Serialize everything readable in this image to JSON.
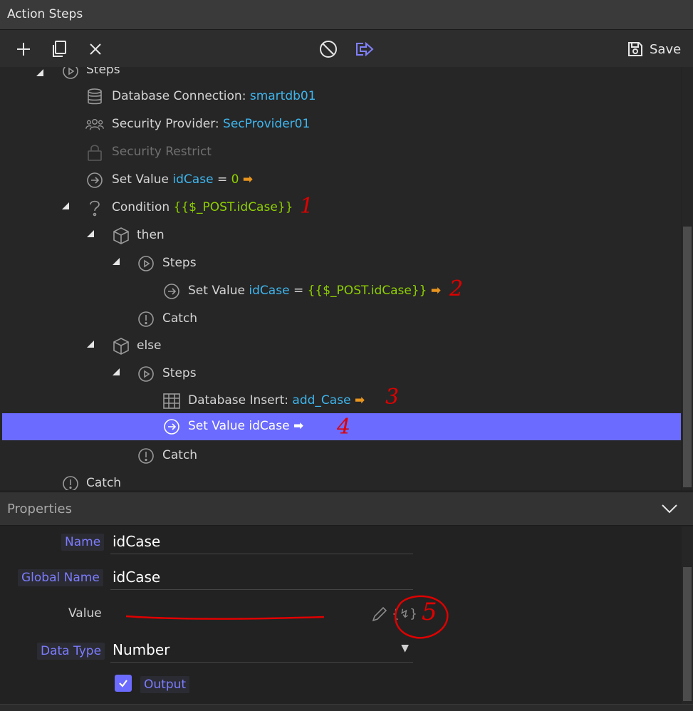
{
  "panel_title": "Action Steps",
  "toolbar": {
    "save_label": "Save"
  },
  "tree": {
    "steps_label": "Steps",
    "db_connection": {
      "label": "Database Connection:",
      "value": "smartdb01"
    },
    "security_provider": {
      "label": "Security Provider:",
      "value": "SecProvider01"
    },
    "security_restrict": {
      "label": "Security Restrict"
    },
    "set_value_1": {
      "label": "Set Value",
      "name": "idCase",
      "eq": "=",
      "value": "0"
    },
    "condition": {
      "label": "Condition",
      "expr": "{{$_POST.idCase}}"
    },
    "then_label": "then",
    "then_steps_label": "Steps",
    "set_value_2": {
      "label": "Set Value",
      "name": "idCase",
      "eq": "=",
      "value": "{{$_POST.idCase}}"
    },
    "then_catch_label": "Catch",
    "else_label": "else",
    "else_steps_label": "Steps",
    "db_insert": {
      "label": "Database Insert:",
      "value": "add_Case"
    },
    "set_value_3": {
      "label": "Set Value idCase"
    },
    "else_catch_label": "Catch",
    "catch_label": "Catch"
  },
  "annotations": [
    "1",
    "2",
    "3",
    "4",
    "5"
  ],
  "properties": {
    "header": "Properties",
    "name_label": "Name",
    "name_value": "idCase",
    "global_name_label": "Global Name",
    "global_name_value": "idCase",
    "value_label": "Value",
    "value_value": "",
    "data_type_label": "Data Type",
    "data_type_value": "Number",
    "output_label": "Output",
    "output_checked": true
  },
  "colors": {
    "selection": "#6b6bff",
    "link_blue": "#3fb6ee",
    "expr_green": "#8fd000",
    "exit_orange": "#e8941e",
    "annotation_red": "#e00000"
  }
}
